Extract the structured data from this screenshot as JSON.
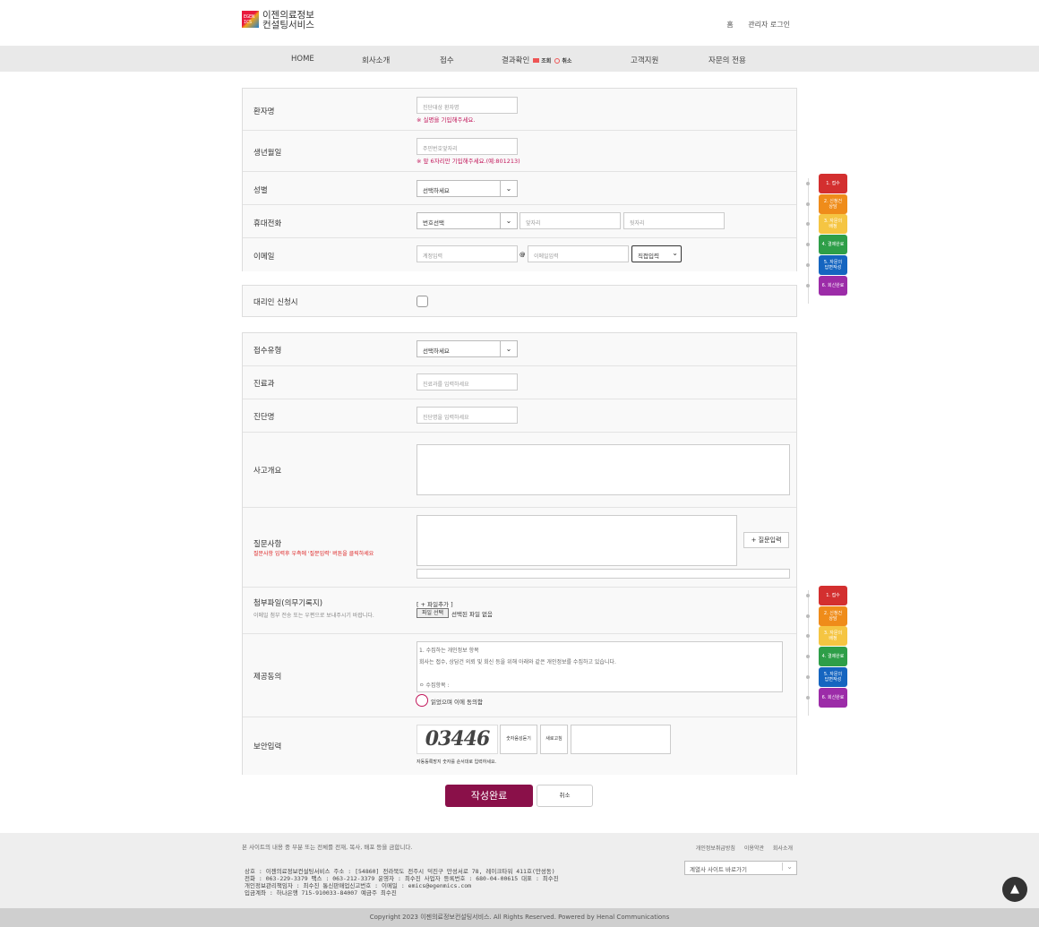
{
  "header": {
    "logo_mark": "EGEN\nICS",
    "logo_line1": "이젠의료정보",
    "logo_line2": "컨설팅서비스",
    "link_home": "홈",
    "link_admin": "관리자 로그인"
  },
  "nav": {
    "home": "HOME",
    "about": "회사소개",
    "receipt": "접수",
    "result": "결과확인",
    "result_view": "조회",
    "result_cancel": "취소",
    "support": "고객지원",
    "advisory": "자문의 전용"
  },
  "form": {
    "patient_label": "환자명",
    "patient_placeholder": "진단대상 환자명",
    "patient_note": "※ 실명을 기입해주세요.",
    "birth_label": "생년월일",
    "birth_placeholder": "주민번호앞자리",
    "birth_note": "※ 앞 6자리만 기입해주세요.(예:801213)",
    "gender_label": "성별",
    "gender_select": "선택하세요",
    "phone_label": "휴대전화",
    "phone_select": "번호선택",
    "phone_mid": "앞자리",
    "phone_last": "뒷자리",
    "email_label": "이메일",
    "email_id": "계정입력",
    "email_at": "@",
    "email_domain": "이메일입력",
    "email_select": "직접입력",
    "proxy_label": "대리인 신청시",
    "type_label": "접수유형",
    "type_select": "선택하세요",
    "dept_label": "진료과",
    "dept_placeholder": "진료과를 입력하세요",
    "diag_label": "진단명",
    "diag_placeholder": "진단명을 입력하세요",
    "accident_label": "사고개요",
    "question_label": "질문사항",
    "question_hint": "질문사항 입력후 우측에 '질문입력' 버튼을 클릭하세요",
    "question_btn": "+ 질문입력",
    "attach_label": "첨부파일(의무기록지)",
    "attach_hint": "이메일 첨부 전송 또는 우편으로 보내주시기 바랍니다.",
    "attach_add": "[ + 파일추가 ]",
    "file_btn": "파일 선택",
    "file_status": "선택된 파일 없음",
    "consent_label": "제공동의",
    "consent_line1": "1. 수집하는 개인정보 항목",
    "consent_line2": "회사는 접수, 상담건 의뢰 및 회신 등을 위해 아래와 같은 개인정보를 수집하고 있습니다.",
    "consent_line3": "ㅇ 수집항목 :",
    "consent_agree": "읽었으며 이에 동의함",
    "captcha_label": "보안입력",
    "captcha_text": "03446",
    "captcha_audio": "숫자음성듣기",
    "captcha_refresh": "새로고침",
    "captcha_note": "자동등록방지 숫자를 순서대로 입력하세요."
  },
  "steps": [
    {
      "label": "1. 접수",
      "color": "#d32f2f"
    },
    {
      "label": "2. 신청건\n상담",
      "color": "#ef8c1a"
    },
    {
      "label": "3. 자문의\n배정",
      "color": "#f5c542"
    },
    {
      "label": "4. 결제완료",
      "color": "#2e9e48"
    },
    {
      "label": "5. 자문의\n답변작성",
      "color": "#1565c0"
    },
    {
      "label": "6. 회신완료",
      "color": "#9c2ca8"
    }
  ],
  "buttons": {
    "submit": "작성완료",
    "cancel": "취소"
  },
  "footer": {
    "disclaimer": "본 사이트의 내용 중 부분 또는 전체를 전재, 복사, 배포 등을 금합니다.",
    "line1": "상호 : 이젠의료정보컨설팅서비스   주소 : [54860] 전라북도 전주시 덕진구 만성서로 78, 레이크타워 411호(만성동)",
    "line2": "전화 : 063-229-3379   팩스 : 063-212-3379   운영자 : 최수진   사업자 등록번호 : 680-04-00615   대표 : 최수진",
    "line3": "개인정보관리책임자 : 최수진   통신판매업신고번호 :    이메일 : emics@egenmics.com",
    "line4": "입금계좌 : 하나은행 715-910033-84007 예금주 최수진",
    "privacy": "개인정보취급방침",
    "terms": "이용약관",
    "company": "회사소개",
    "family": "계열사 사이트 바로가기",
    "copyright": "Copyright 2023 이젠의료정보컨설팅서비스. All Rights Reserved. Powered by Henal Communications"
  }
}
